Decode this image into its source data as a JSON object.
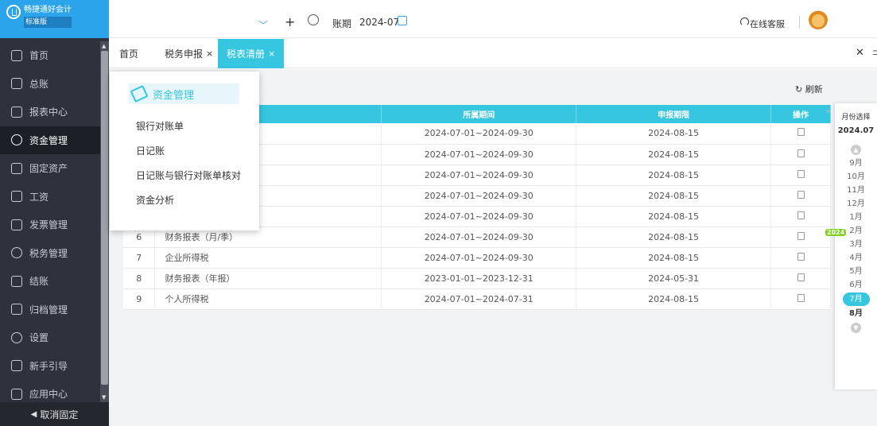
{
  "brand": {
    "name": "畅捷通好会计",
    "edition": "标准版"
  },
  "header": {
    "period_label": "账期",
    "period_value": "2024-07",
    "plus": "+",
    "support_label": "在线客服"
  },
  "sidebar": {
    "items": [
      {
        "label": "首页"
      },
      {
        "label": "总账"
      },
      {
        "label": "报表中心"
      },
      {
        "label": "资金管理"
      },
      {
        "label": "固定资产"
      },
      {
        "label": "工资"
      },
      {
        "label": "发票管理"
      },
      {
        "label": "税务管理"
      },
      {
        "label": "结账"
      },
      {
        "label": "归档管理"
      },
      {
        "label": "设置"
      },
      {
        "label": "新手引导"
      },
      {
        "label": "应用中心"
      }
    ],
    "active_index": 3,
    "unpin_label": "取消固定"
  },
  "tabs": [
    {
      "label": "首页",
      "close": ""
    },
    {
      "label": "税务申报",
      "close": "×"
    },
    {
      "label": "税表清册",
      "close": "×"
    }
  ],
  "toolbar": {
    "refresh_label": "刷新"
  },
  "table": {
    "headers": [
      "",
      "",
      "所属期间",
      "申报期限",
      "操作"
    ],
    "rows": [
      {
        "no": "",
        "name": "",
        "period": "2024-07-01~2024-09-30",
        "deadline": "2024-08-15"
      },
      {
        "no": "",
        "name": "",
        "period": "2024-07-01~2024-09-30",
        "deadline": "2024-08-15"
      },
      {
        "no": "",
        "name": "",
        "period": "2024-07-01~2024-09-30",
        "deadline": "2024-08-15"
      },
      {
        "no": "",
        "name": "",
        "period": "2024-07-01~2024-09-30",
        "deadline": "2024-08-15"
      },
      {
        "no": "",
        "name": "",
        "period": "2024-07-01~2024-09-30",
        "deadline": "2024-08-15"
      },
      {
        "no": "6",
        "name": "财务报表（月/季）",
        "period": "2024-07-01~2024-09-30",
        "deadline": "2024-08-15"
      },
      {
        "no": "7",
        "name": "企业所得税",
        "period": "2024-07-01~2024-09-30",
        "deadline": "2024-08-15"
      },
      {
        "no": "8",
        "name": "财务报表（年报）",
        "period": "2023-01-01~2023-12-31",
        "deadline": "2024-05-31"
      },
      {
        "no": "9",
        "name": "个人所得税",
        "period": "2024-07-01~2024-07-31",
        "deadline": "2024-08-15"
      }
    ]
  },
  "month_panel": {
    "title": "月份选择",
    "current": "2024.07",
    "year_badge": "2024",
    "months": [
      "9月",
      "10月",
      "11月",
      "12月",
      "1月",
      "2月",
      "3月",
      "4月",
      "5月",
      "6月",
      "7月",
      "8月"
    ],
    "selected": "7月"
  },
  "dropdown": {
    "title": "资金管理",
    "items": [
      "银行对账单",
      "日记账",
      "日记账与银行对账单核对",
      "资金分析"
    ]
  },
  "colors": {
    "accent": "#37c6e0",
    "sidebar_bg": "#2f323d",
    "brand_bg": "#2ba4ec"
  }
}
